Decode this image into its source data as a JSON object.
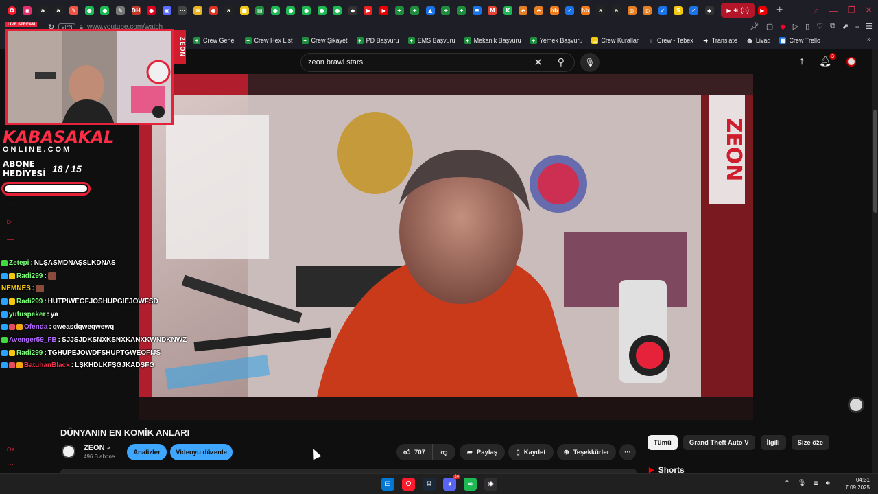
{
  "browser": {
    "url": "www.youtube.com/watch",
    "vpn_label": "VPN",
    "active_tab_label": "(3)",
    "tab_favicons": [
      {
        "name": "ig",
        "color": "#e1306c",
        "glyph": "◉"
      },
      {
        "name": "amazon",
        "color": "#222",
        "glyph": "a"
      },
      {
        "name": "amazon2",
        "color": "#222",
        "glyph": "a"
      },
      {
        "name": "tool",
        "color": "#e54",
        "glyph": "✎"
      },
      {
        "name": "g1",
        "color": "#1db954",
        "glyph": "●"
      },
      {
        "name": "g2",
        "color": "#1db954",
        "glyph": "●"
      },
      {
        "name": "tool2",
        "color": "#777",
        "glyph": "✎"
      },
      {
        "name": "dh",
        "color": "#c0392b",
        "glyph": "DH"
      },
      {
        "name": "red",
        "color": "#e0001b",
        "glyph": "●"
      },
      {
        "name": "img",
        "color": "#5b6cff",
        "glyph": "▣"
      },
      {
        "name": "dots",
        "color": "#444",
        "glyph": "⋯"
      },
      {
        "name": "star",
        "color": "#e6b422",
        "glyph": "✱"
      },
      {
        "name": "red2",
        "color": "#d32",
        "glyph": "●"
      },
      {
        "name": "amazon3",
        "color": "#222",
        "glyph": "a"
      },
      {
        "name": "yel",
        "color": "#f2c811",
        "glyph": "■"
      },
      {
        "name": "sheets",
        "color": "#1e8e3e",
        "glyph": "▤"
      },
      {
        "name": "g3",
        "color": "#1db954",
        "glyph": "●"
      },
      {
        "name": "g4",
        "color": "#1db954",
        "glyph": "●"
      },
      {
        "name": "g5",
        "color": "#1db954",
        "glyph": "●"
      },
      {
        "name": "g6",
        "color": "#1db954",
        "glyph": "●"
      },
      {
        "name": "g7",
        "color": "#1db954",
        "glyph": "●"
      },
      {
        "name": "dia",
        "color": "#333",
        "glyph": "◆"
      },
      {
        "name": "ytred",
        "color": "#e22",
        "glyph": "▶"
      },
      {
        "name": "yt",
        "color": "#e00",
        "glyph": "▶"
      },
      {
        "name": "plus1",
        "color": "#1e8e3e",
        "glyph": "+"
      },
      {
        "name": "plus2",
        "color": "#1e8e3e",
        "glyph": "+"
      },
      {
        "name": "drive",
        "color": "#1a73e8",
        "glyph": "▲"
      },
      {
        "name": "plus3",
        "color": "#1e8e3e",
        "glyph": "+"
      },
      {
        "name": "plus4",
        "color": "#1e8e3e",
        "glyph": "+"
      },
      {
        "name": "docs",
        "color": "#1a73e8",
        "glyph": "≡"
      },
      {
        "name": "gmail",
        "color": "#ea4335",
        "glyph": "M"
      },
      {
        "name": "k",
        "color": "#1db954",
        "glyph": "K"
      },
      {
        "name": "e1",
        "color": "#e67e22",
        "glyph": "e"
      },
      {
        "name": "e2",
        "color": "#e67e22",
        "glyph": "e"
      },
      {
        "name": "hb",
        "color": "#f27a1a",
        "glyph": "hb"
      },
      {
        "name": "check",
        "color": "#1a73e8",
        "glyph": "✓"
      },
      {
        "name": "hb2",
        "color": "#f27a1a",
        "glyph": "hb"
      },
      {
        "name": "amazon4",
        "color": "#222",
        "glyph": "a"
      },
      {
        "name": "amazon5",
        "color": "#222",
        "glyph": "a"
      },
      {
        "name": "circ1",
        "color": "#e67e22",
        "glyph": "◎"
      },
      {
        "name": "circ2",
        "color": "#e67e22",
        "glyph": "◎"
      },
      {
        "name": "check2",
        "color": "#1a73e8",
        "glyph": "✓"
      },
      {
        "name": "s",
        "color": "#f2c811",
        "glyph": "S"
      },
      {
        "name": "check3",
        "color": "#1a73e8",
        "glyph": "✓"
      },
      {
        "name": "dia2",
        "color": "#333",
        "glyph": "◆"
      }
    ]
  },
  "bookmarks": [
    {
      "label": "Crew Genel",
      "color": "#1e8e3e",
      "glyph": "+"
    },
    {
      "label": "Crew Hex List",
      "color": "#1e8e3e",
      "glyph": "+"
    },
    {
      "label": "Crew Şikayet",
      "color": "#1e8e3e",
      "glyph": "+"
    },
    {
      "label": "PD Başvuru",
      "color": "#1e8e3e",
      "glyph": "+"
    },
    {
      "label": "EMS Başvuru",
      "color": "#1e8e3e",
      "glyph": "+"
    },
    {
      "label": "Mekanik Başvuru",
      "color": "#1e8e3e",
      "glyph": "+"
    },
    {
      "label": "Yemek Başvuru",
      "color": "#1e8e3e",
      "glyph": "+"
    },
    {
      "label": "Crew Kurallar",
      "color": "#f2c811",
      "glyph": "▭"
    },
    {
      "label": "Crew - Tebex",
      "color": "#1e1f26",
      "glyph": "↑"
    },
    {
      "label": "Translate",
      "color": "#1e1f26",
      "glyph": "➜"
    },
    {
      "label": "Livad",
      "color": "#1e1f26",
      "glyph": "◍"
    },
    {
      "label": "Crew Trello",
      "color": "#1a73e8",
      "glyph": "▦"
    }
  ],
  "youtube": {
    "search_query": "zeon brawl stars",
    "notification_count": "3",
    "video_title": "DÜNYANIN EN KOMİK ANLARI",
    "channel_name": "ZEON",
    "channel_verified": "✔",
    "subscribers": "496 B abone",
    "analytics_button": "Analizler",
    "edit_button": "Videoyu düzenle",
    "like_count": "707",
    "share_label": "Paylaş",
    "save_label": "Kaydet",
    "thanks_label": "Teşekkürler",
    "more_label": "···",
    "chips": [
      {
        "label": "Tümü",
        "selected": true
      },
      {
        "label": "Grand Theft Auto V",
        "selected": false
      },
      {
        "label": "İlgili",
        "selected": false
      },
      {
        "label": "Size öze",
        "selected": false
      }
    ],
    "shorts_label": "Shorts"
  },
  "stream_overlay": {
    "live_label": "LIVE STREAM",
    "side_brand": "ZEON",
    "brand_name": "KABASAKAL",
    "brand_domain": "ONLINE.COM",
    "sub_gift_label_1": "ABONE",
    "sub_gift_label_2": "HEDİYESİ",
    "sub_gift_count": "18  / 15",
    "sub_gift_progress": 1.0
  },
  "chat": [
    {
      "badges": [
        "#3fdc3f"
      ],
      "user": "Zetepi",
      "user_color": "#7dff7d",
      "text": "NLŞASMDNAŞSLKDNAS",
      "emote": false
    },
    {
      "badges": [
        "#2aa3ff",
        "#f2c811"
      ],
      "user": "Radi299",
      "user_color": "#7dff7d",
      "text": "",
      "emote": true
    },
    {
      "badges": [],
      "user": "NEMNES",
      "user_color": "#f2c811",
      "text": "",
      "emote": true
    },
    {
      "badges": [
        "#2aa3ff",
        "#f2c811"
      ],
      "user": "Radi299",
      "user_color": "#7dff7d",
      "text": "HUTPIWEGFJOSHUPGIEJOWFSD",
      "emote": false
    },
    {
      "badges": [
        "#2aa3ff"
      ],
      "user": "yufuspeker",
      "user_color": "#7dff7d",
      "text": "ya",
      "emote": false
    },
    {
      "badges": [
        "#2aa3ff",
        "#e84a5f",
        "#f2a811"
      ],
      "user": "Ofenda",
      "user_color": "#b46bff",
      "text": "qweasdqweqwewq",
      "emote": false
    },
    {
      "badges": [
        "#3fdc3f"
      ],
      "user": "Avenger59_FB",
      "user_color": "#b46bff",
      "text": "SJJSJDKSNXKSNXKANXKWNDKNWZ",
      "emote": false
    },
    {
      "badges": [
        "#2aa3ff",
        "#f2c811"
      ],
      "user": "Radi299",
      "user_color": "#7dff7d",
      "text": "TGHUPEJOWDFSHUPTGWEOFIJS",
      "emote": false
    },
    {
      "badges": [
        "#2aa3ff",
        "#e84a5f",
        "#f2a811"
      ],
      "user": "BatuhanBlack",
      "user_color": "#e8304a",
      "text": "LŞKHDLKFŞGJKADŞFG",
      "emote": false
    }
  ],
  "taskbar": {
    "time": "04:31",
    "date": "7.09.2025",
    "apps": [
      {
        "name": "windows-start",
        "color": "#0078d4",
        "glyph": "⊞"
      },
      {
        "name": "opera",
        "color": "#ff1b2d",
        "glyph": "O"
      },
      {
        "name": "steam",
        "color": "#1b2838",
        "glyph": "⚙"
      },
      {
        "name": "discord",
        "color": "#5865f2",
        "glyph": "◕"
      },
      {
        "name": "spotify",
        "color": "#1db954",
        "glyph": "≋"
      },
      {
        "name": "obs",
        "color": "#302e31",
        "glyph": "◉"
      }
    ],
    "discord_badge": "24"
  }
}
